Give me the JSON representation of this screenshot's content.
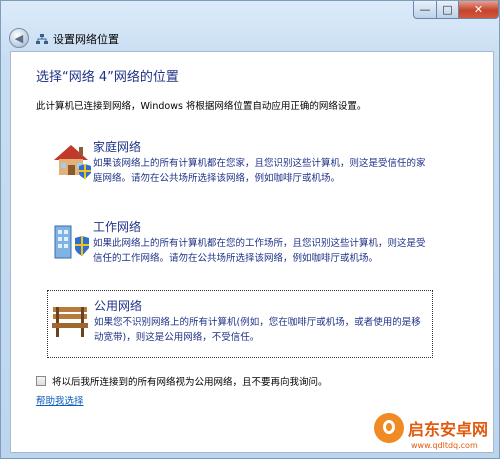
{
  "window": {
    "title": "设置网络位置",
    "controls": {
      "minimize": "—",
      "maximize": "□",
      "close": "✕"
    }
  },
  "nav": {
    "back_glyph": "◀"
  },
  "main": {
    "heading": "选择“网络 4”网络的位置",
    "intro": "此计算机已连接到网络，Windows 将根据网络位置自动应用正确的网络设置。",
    "options": [
      {
        "title": "家庭网络",
        "desc": "如果该网络上的所有计算机都在您家，且您识别这些计算机，则这是受信任的家庭网络。请勿在公共场所选择该网络，例如咖啡厅或机场。",
        "icon": "house-icon"
      },
      {
        "title": "工作网络",
        "desc": "如果此网络上的所有计算机都在您的工作场所，且您识别这些计算机，则这是受信任的工作网络。请勿在公共场所选择该网络，例如咖啡厅或机场。",
        "icon": "office-building-icon"
      },
      {
        "title": "公用网络",
        "desc": "如果您不识别网络上的所有计算机(例如，您在咖啡厅或机场，或者使用的是移动宽带)，则这是公用网络，不受信任。",
        "icon": "park-bench-icon"
      }
    ],
    "checkbox_label": "将以后我所连接到的所有网络视为公用网络，且不要再向我询问。",
    "checkbox_checked": false,
    "help_link": "帮助我选择"
  },
  "watermark": {
    "text": "启东安卓网",
    "url": "www.qdltdq.com"
  }
}
